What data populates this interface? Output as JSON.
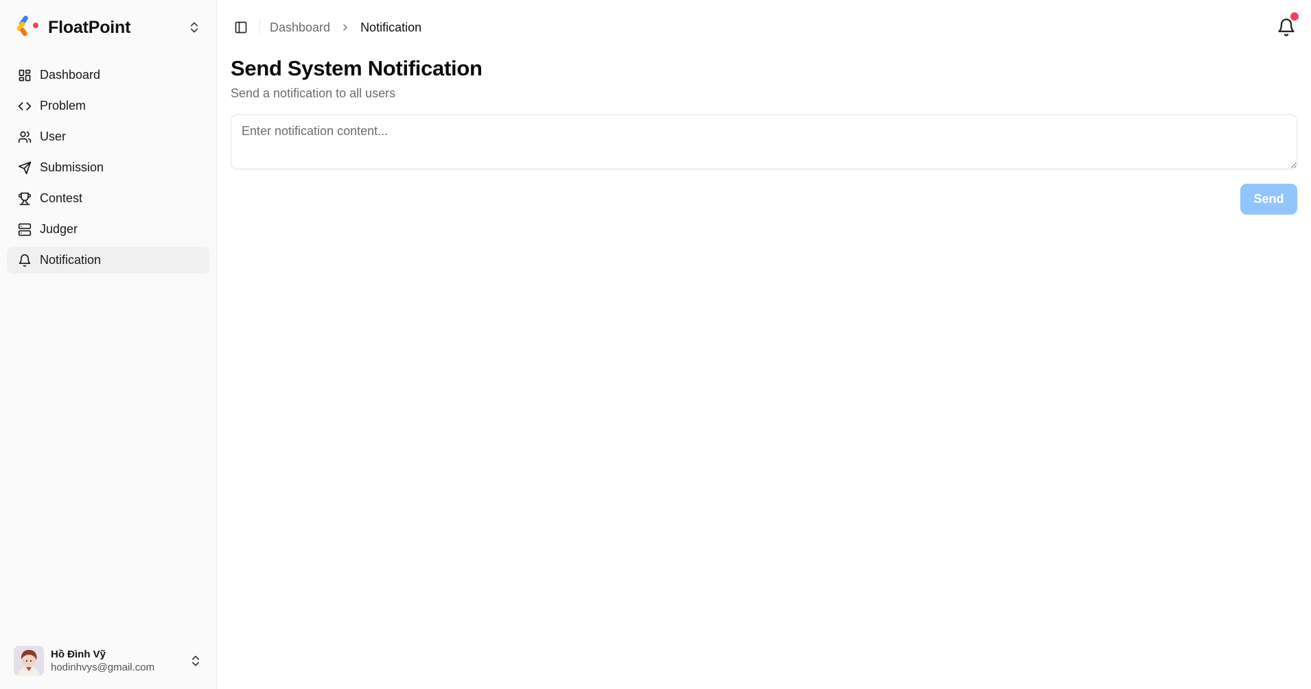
{
  "brand": {
    "name": "FloatPoint"
  },
  "sidebar": {
    "items": [
      {
        "label": "Dashboard",
        "icon": "dashboard-icon"
      },
      {
        "label": "Problem",
        "icon": "code-icon"
      },
      {
        "label": "User",
        "icon": "users-icon"
      },
      {
        "label": "Submission",
        "icon": "send-icon"
      },
      {
        "label": "Contest",
        "icon": "trophy-icon"
      },
      {
        "label": "Judger",
        "icon": "server-icon"
      },
      {
        "label": "Notification",
        "icon": "bell-icon",
        "active": true
      }
    ]
  },
  "user": {
    "name": "Hồ Đình Vỹ",
    "email": "hodinhvys@gmail.com"
  },
  "breadcrumb": {
    "parent": "Dashboard",
    "current": "Notification"
  },
  "page": {
    "title": "Send System Notification",
    "subtitle": "Send a notification to all users"
  },
  "form": {
    "placeholder": "Enter notification content...",
    "value": "",
    "send_label": "Send"
  },
  "colors": {
    "accent_disabled": "#93c5fd",
    "badge": "#f43f5e",
    "sidebar_bg": "#fafafa"
  }
}
